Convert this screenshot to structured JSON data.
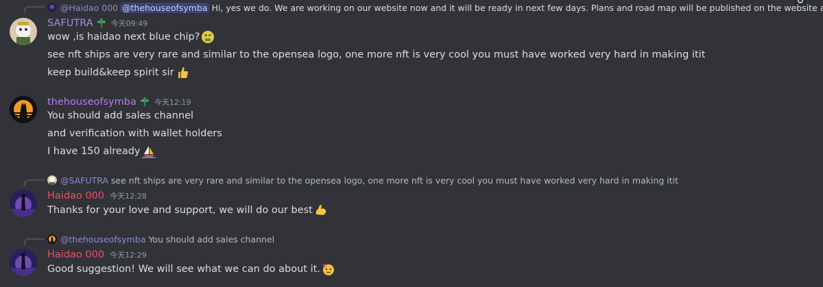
{
  "messages": [
    {
      "reply": {
        "mention": "@Haidao 000",
        "target": "@thehouseofsymba",
        "text": "Hi, yes we do. We are working on our website now and it will be ready in next few days. Plans and road map will be published on the website as well."
      },
      "author": "SAFUTRA",
      "author_color": "#a98be8",
      "time": "今天09:49",
      "lines": [
        "wow ,is haidao next blue chip?",
        "see nft ships are very rare and similar to the opensea logo, one more nft is very cool you must have worked very hard in making itit",
        "keep build&keep spirit sir"
      ]
    },
    {
      "author": "thehouseofsymba",
      "author_color": "#b27cf2",
      "time": "今天12:19",
      "lines": [
        "You should add sales channel",
        "and verification with wallet holders",
        "I have 150 already"
      ]
    },
    {
      "reply": {
        "mention": "@SAFUTRA",
        "text": "see nft ships are very rare and similar to the opensea logo, one more nft is very cool you must have worked very hard in making itit"
      },
      "author": "Haidao 000",
      "author_color": "#f04d6f",
      "time": "今天12:28",
      "lines": [
        "Thanks for your love and support, we will do our best"
      ]
    },
    {
      "reply": {
        "mention": "@thehouseofsymba",
        "text": "You should add sales channel"
      },
      "author": "Haidao 000",
      "author_color": "#f04d6f",
      "time": "今天12:29",
      "lines": [
        "Good suggestion! We will see what we can do about it."
      ]
    }
  ],
  "icons": {
    "top_right": "settings-icon",
    "emoji_money": "money-mouth-emoji",
    "emoji_thumbs": "thumbs-up-emoji",
    "emoji_boat": "sailboat-emoji",
    "emoji_muscle": "flexed-biceps-emoji",
    "emoji_party": "partying-face-emoji",
    "role_badge": "leaf-badge-icon"
  }
}
